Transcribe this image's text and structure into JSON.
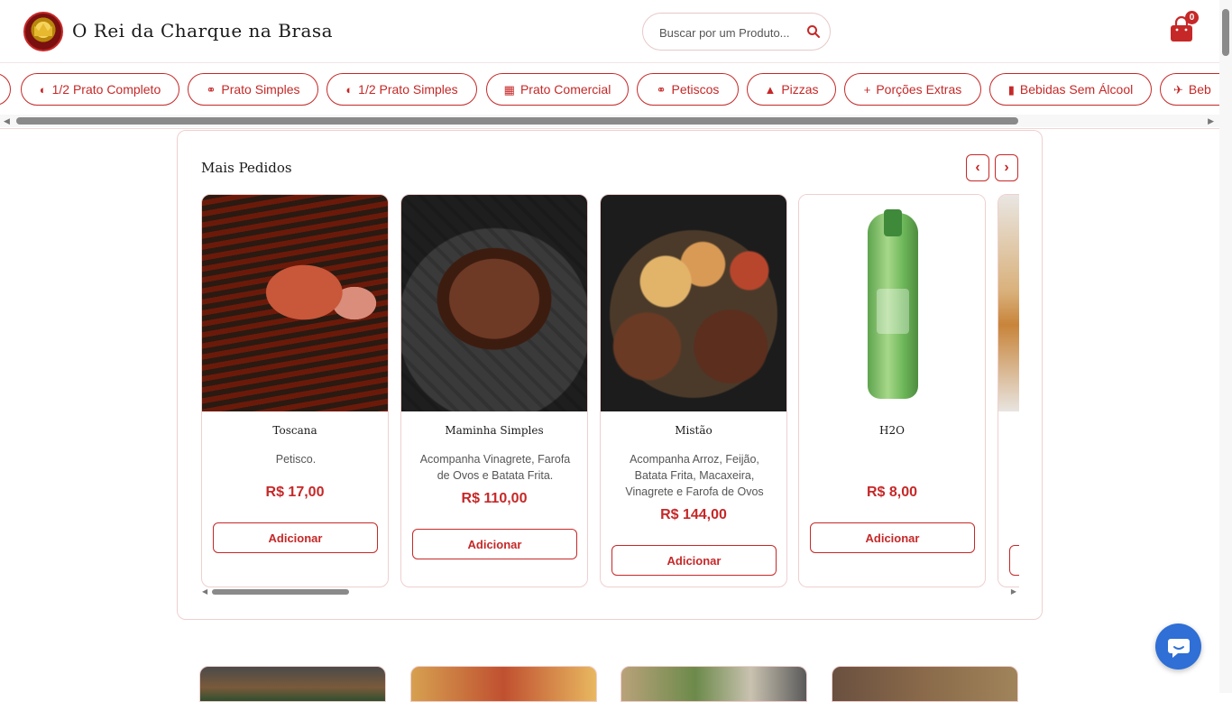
{
  "header": {
    "brand": "O Rei da Charque na Brasa",
    "search_placeholder": "Buscar por um Produto...",
    "cart_count": "0"
  },
  "categories": [
    {
      "label": "1/2 Prato Completo",
      "icon": "half-circle-icon"
    },
    {
      "label": "Prato Simples",
      "icon": "dish-icon"
    },
    {
      "label": "1/2 Prato Simples",
      "icon": "half-circle-icon"
    },
    {
      "label": "Prato Comercial",
      "icon": "tray-icon"
    },
    {
      "label": "Petiscos",
      "icon": "dish-icon"
    },
    {
      "label": "Pizzas",
      "icon": "pizza-icon"
    },
    {
      "label": "Porções Extras",
      "icon": "plus-icon"
    },
    {
      "label": "Bebidas Sem Álcool",
      "icon": "glass-icon"
    },
    {
      "label": "Beb",
      "icon": "glasses-icon"
    }
  ],
  "section": {
    "title": "Mais Pedidos",
    "prev": "‹",
    "next": "›"
  },
  "products": [
    {
      "name": "Toscana",
      "description": "Petisco.",
      "price": "R$ 17,00",
      "button": "Adicionar"
    },
    {
      "name": "Maminha Simples",
      "description": "Acompanha Vinagrete, Farofa de Ovos e Batata Frita.",
      "price": "R$ 110,00",
      "button": "Adicionar"
    },
    {
      "name": "Mistão",
      "description": "Acompanha Arroz, Feijão, Batata Frita, Macaxeira, Vinagrete e Farofa de Ovos",
      "price": "R$ 144,00",
      "button": "Adicionar"
    },
    {
      "name": "H2O",
      "description": "",
      "price": "R$ 8,00",
      "button": "Adicionar"
    }
  ],
  "colors": {
    "accent": "#c62828",
    "chat": "#2f6fd6"
  }
}
